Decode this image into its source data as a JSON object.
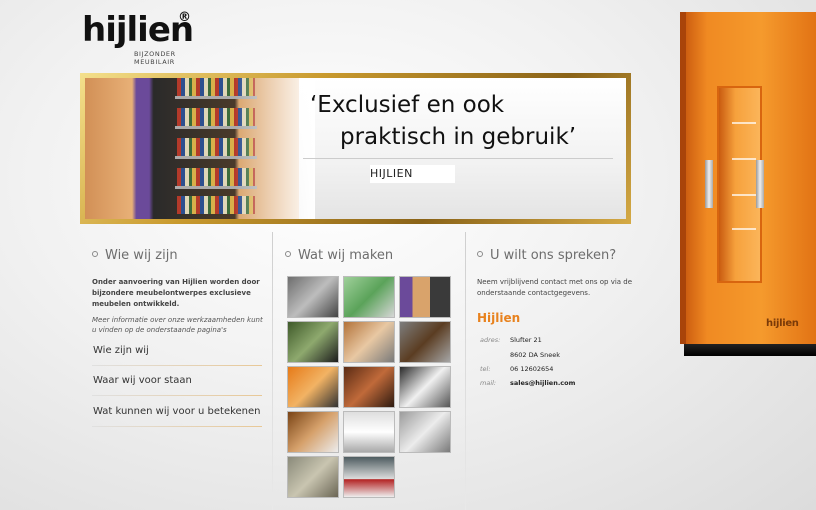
{
  "logo": {
    "word": "hijlien",
    "registered": "®",
    "sub1": "BIJZONDER",
    "sub2": "MEUBILAIR"
  },
  "banner": {
    "slogan_line1": "‘Exclusief en ook",
    "slogan_line2": "praktisch in gebruik’",
    "brand": "HIJLIEN"
  },
  "about": {
    "title": "Wie wij zijn",
    "intro": "Onder aanvoering van Hijlien worden door bijzondere meubelontwerpes exclusieve meubelen ontwikkeld.",
    "intro2": "Meer informatie over onze werkzaamheden kunt u vinden op de onderstaande pagina's",
    "links": [
      "Wie zijn wij",
      "Waar wij voor staan",
      "Wat kunnen wij voor u betekenen"
    ]
  },
  "gallery": {
    "title": "Wat wij maken",
    "thumbs": [
      "photo-1",
      "photo-2",
      "photo-3",
      "photo-4",
      "photo-5",
      "photo-6",
      "photo-7",
      "photo-8",
      "photo-9",
      "photo-10",
      "photo-11",
      "photo-12",
      "photo-13",
      "photo-14"
    ]
  },
  "contact": {
    "title": "U wilt ons spreken?",
    "intro": "Neem vrijblijvend contact met ons op via de onderstaande contactgegevens.",
    "name": "Hijlien",
    "address_label": "adres:",
    "address_line1": "Slufter 21",
    "address_line2": "8602 DA Sneek",
    "tel_label": "tel:",
    "tel": "06 12602654",
    "mail_label": "mail:",
    "mail": "sales@hijlien.com"
  },
  "cabinet": {
    "brand": "hijlien"
  },
  "colors": {
    "accent": "#e8821e",
    "gold": "#c99a2e",
    "text": "#333333"
  }
}
